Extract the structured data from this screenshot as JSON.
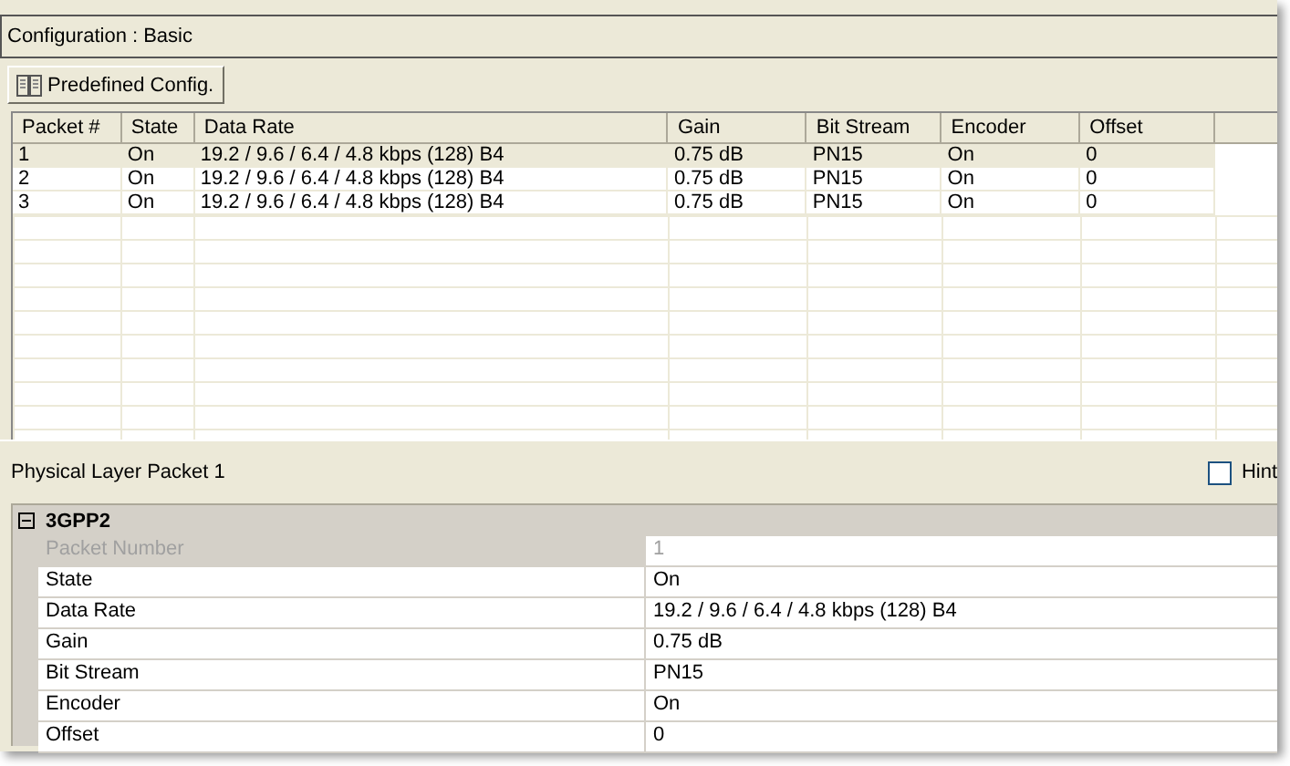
{
  "configuration": {
    "label": "Configuration : Basic"
  },
  "toolbar": {
    "predefined_button": "Predefined Config."
  },
  "table": {
    "columns": [
      "Packet #",
      "State",
      "Data Rate",
      "Gain",
      "Bit Stream",
      "Encoder",
      "Offset"
    ],
    "rows": [
      {
        "cells": [
          "1",
          "On",
          "19.2 / 9.6 / 6.4 / 4.8 kbps (128) B4",
          "0.75 dB",
          "PN15",
          "On",
          "0"
        ],
        "selected": true
      },
      {
        "cells": [
          "2",
          "On",
          "19.2 / 9.6 / 6.4 / 4.8 kbps (128) B4",
          "0.75 dB",
          "PN15",
          "On",
          "0"
        ],
        "selected": false
      },
      {
        "cells": [
          "3",
          "On",
          "19.2 / 9.6 / 6.4 / 4.8 kbps (128) B4",
          "0.75 dB",
          "PN15",
          "On",
          "0"
        ],
        "selected": false
      }
    ]
  },
  "details": {
    "title": "Physical Layer Packet 1",
    "hint": {
      "label": "Hint",
      "checked": false
    }
  },
  "properties": {
    "group": {
      "label": "3GPP2",
      "expanded": true
    },
    "rows": [
      {
        "name": "Packet Number",
        "value": "1",
        "disabled": true
      },
      {
        "name": "State",
        "value": "On",
        "disabled": false
      },
      {
        "name": "Data Rate",
        "value": "19.2 / 9.6 / 6.4 / 4.8 kbps (128) B4",
        "disabled": false
      },
      {
        "name": "Gain",
        "value": "0.75 dB",
        "disabled": false
      },
      {
        "name": "Bit Stream",
        "value": "PN15",
        "disabled": false
      },
      {
        "name": "Encoder",
        "value": "On",
        "disabled": false
      },
      {
        "name": "Offset",
        "value": "0",
        "disabled": false
      }
    ]
  }
}
